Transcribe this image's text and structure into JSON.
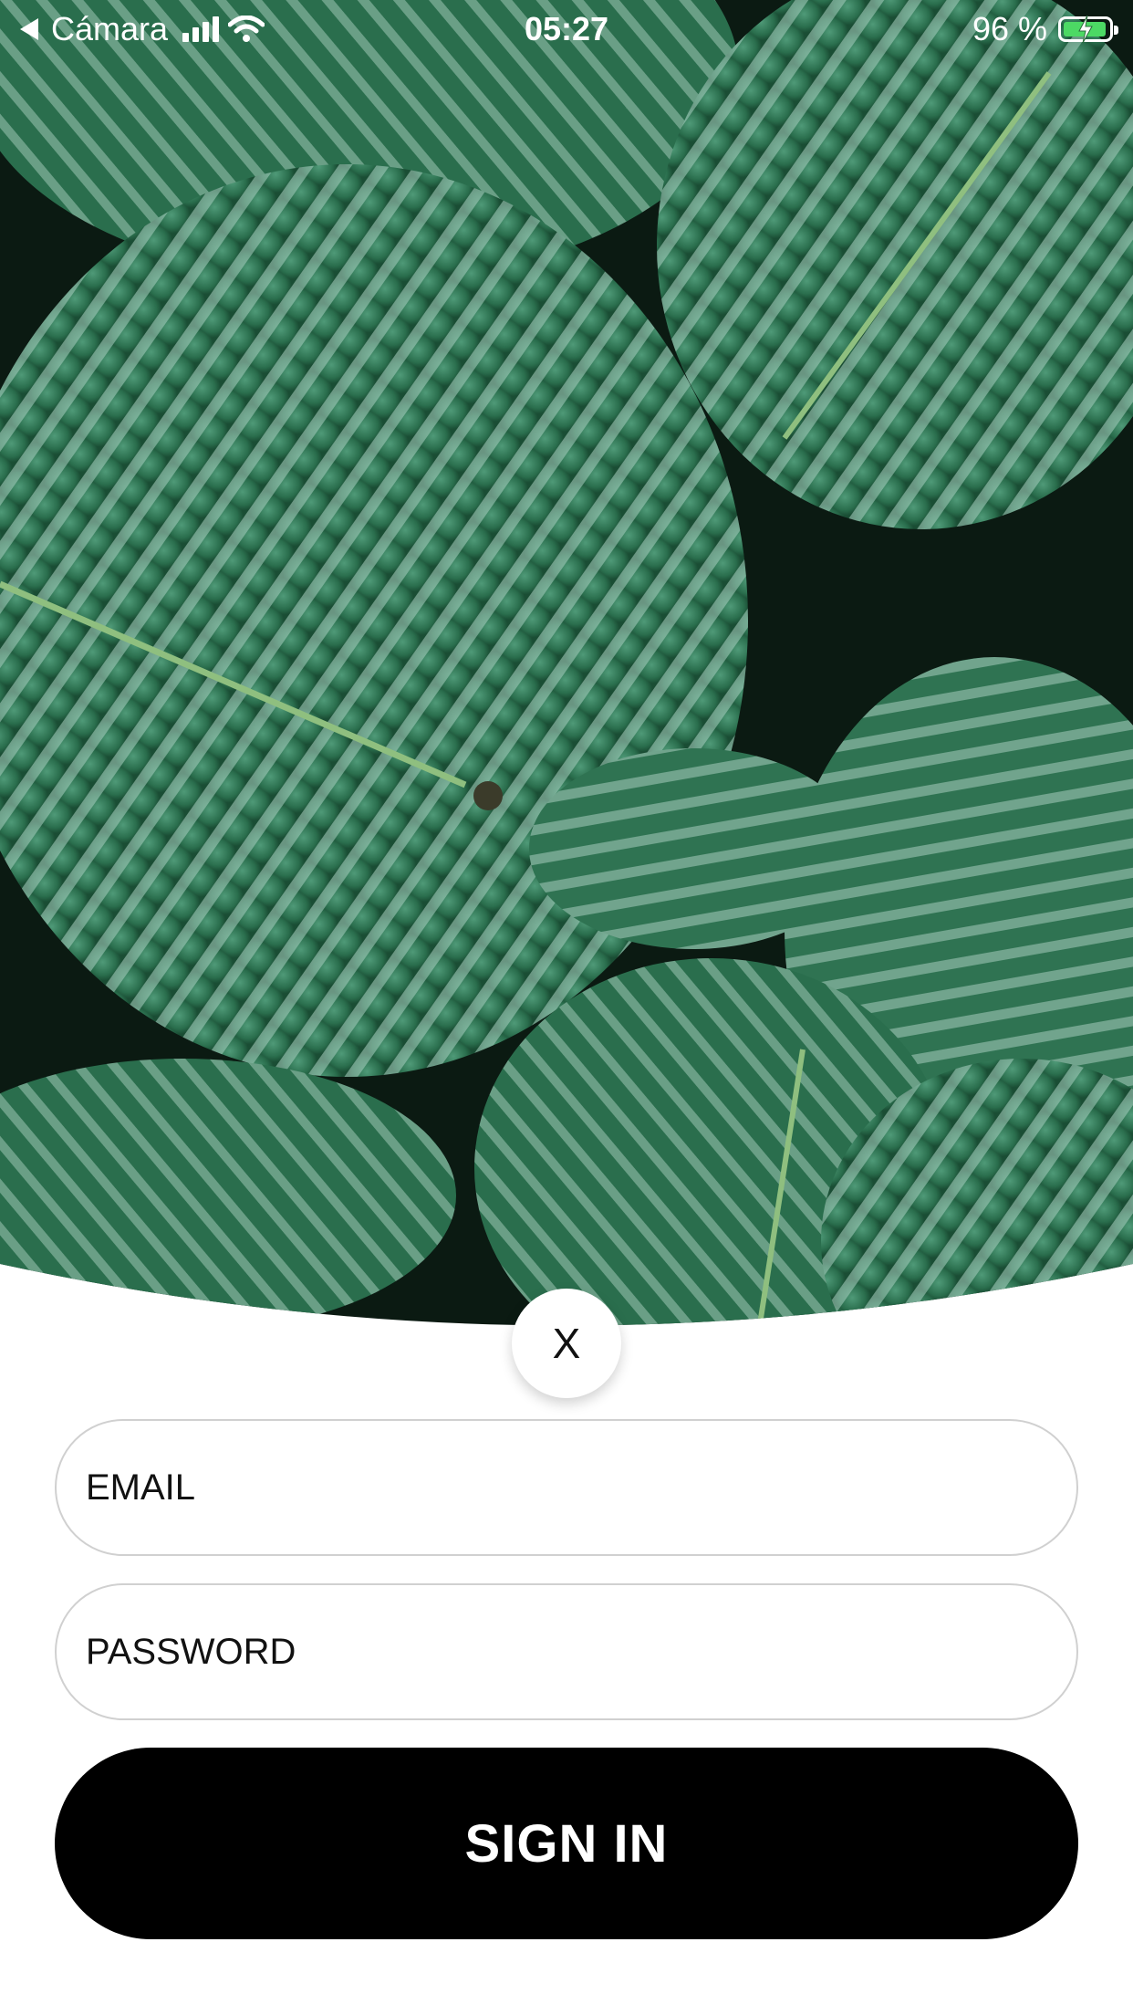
{
  "status_bar": {
    "back_label": "Cámara",
    "time": "05:27",
    "battery_percent_label": "96 %",
    "battery_level": 0.96,
    "charging": true
  },
  "hero": {
    "image_icon": "tropical-leaves-photo",
    "colors": {
      "background": "#0b1a12",
      "leaf_dark": "#1f5a3c",
      "leaf_mid": "#3f8a67",
      "stripe": "#b9d8cc"
    }
  },
  "close": {
    "label": "X"
  },
  "form": {
    "email_placeholder": "EMAIL",
    "password_placeholder": "PASSWORD",
    "submit_label": "SIGN IN"
  },
  "colors": {
    "page_background": "#ffffff",
    "field_border": "#d0d0d0",
    "button_background": "#000000",
    "button_text": "#ffffff"
  }
}
